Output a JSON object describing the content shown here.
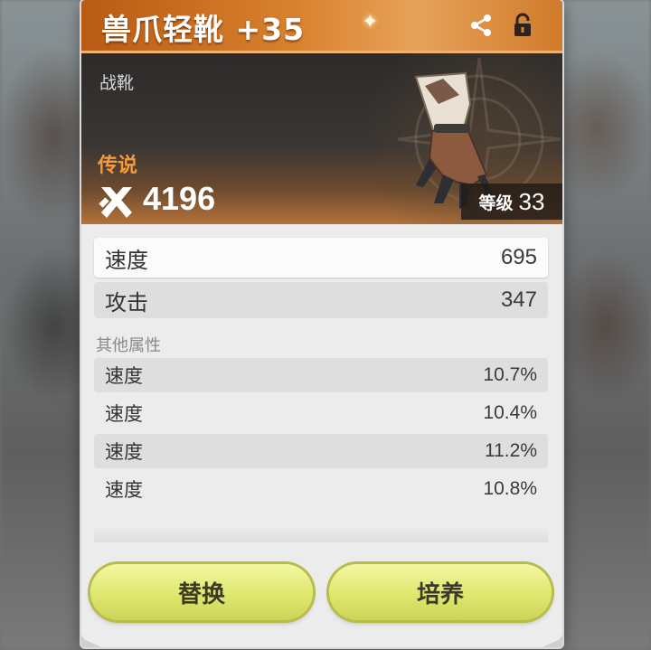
{
  "item": {
    "name": "兽爪轻靴 +35",
    "slot_type": "战靴",
    "rarity": "传说",
    "power": "4196",
    "level_label": "等级",
    "level_value": "33"
  },
  "main_stats": [
    {
      "label": "速度",
      "value": "695"
    },
    {
      "label": "攻击",
      "value": "347"
    }
  ],
  "sub_stats_title": "其他属性",
  "sub_stats": [
    {
      "label": "速度",
      "value": "10.7%"
    },
    {
      "label": "速度",
      "value": "10.4%"
    },
    {
      "label": "速度",
      "value": "11.2%"
    },
    {
      "label": "速度",
      "value": "10.8%"
    }
  ],
  "buttons": {
    "replace": "替换",
    "enhance": "培养"
  },
  "icons": [
    "share-icon",
    "lock-icon",
    "power-icon",
    "item-boot-image"
  ],
  "colors": {
    "title_bar": "#d9822e",
    "rarity": "#f29a3c",
    "button": "#dfe76f"
  }
}
